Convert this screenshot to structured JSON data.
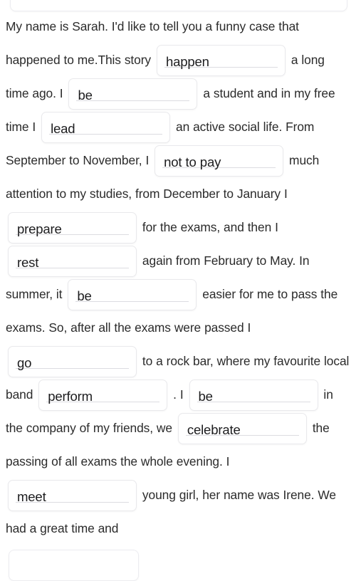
{
  "exercise": {
    "type": "gap-fill",
    "background_color": "#ffffff",
    "text_color": "#2b2b2b",
    "gap_border_color": "#e9e9ec",
    "gap_background_color": "#ffffff",
    "partial_gap_top": "",
    "partial_gap_bottom": "",
    "segments": [
      {
        "kind": "text",
        "value": "My name is Sarah. I'd like to tell you a funny case that happened to me."
      },
      {
        "kind": "text",
        "value": "This story "
      },
      {
        "kind": "gap",
        "value": "happen"
      },
      {
        "kind": "text",
        "value": " a long time ago. I "
      },
      {
        "kind": "gap",
        "value": "be"
      },
      {
        "kind": "text",
        "value": " a student and in my free time I "
      },
      {
        "kind": "gap",
        "value": "lead"
      },
      {
        "kind": "text",
        "value": " an active social life. From September to November, I "
      },
      {
        "kind": "gap",
        "value": "not to pay"
      },
      {
        "kind": "text",
        "value": " much attention to my studies, from December to January I "
      },
      {
        "kind": "gap",
        "value": "prepare"
      },
      {
        "kind": "text",
        "value": " for the exams, and then I "
      },
      {
        "kind": "gap",
        "value": "rest"
      },
      {
        "kind": "text",
        "value": " again from February to May. In summer, it "
      },
      {
        "kind": "gap",
        "value": "be"
      },
      {
        "kind": "text",
        "value": " easier for me to pass the exams. So, after all the exams were passed I "
      },
      {
        "kind": "gap",
        "value": "go"
      },
      {
        "kind": "text",
        "value": " to a rock bar, where my favourite local band "
      },
      {
        "kind": "gap",
        "value": "perform"
      },
      {
        "kind": "text",
        "value": " . I "
      },
      {
        "kind": "gap",
        "value": "be"
      },
      {
        "kind": "text",
        "value": " in the company of my friends, we "
      },
      {
        "kind": "gap",
        "value": "celebrate"
      },
      {
        "kind": "text",
        "value": " the passing of all exams the whole evening. I "
      },
      {
        "kind": "gap",
        "value": "meet"
      },
      {
        "kind": "text",
        "value": " young girl, her name was Irene. We had a great time and"
      }
    ]
  }
}
